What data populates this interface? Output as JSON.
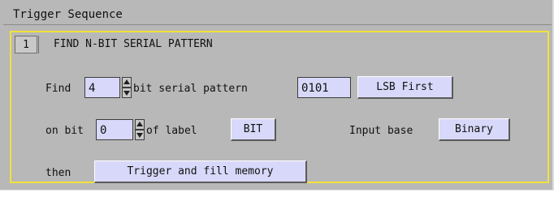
{
  "window": {
    "title": "Trigger Sequence"
  },
  "step": {
    "number": "1",
    "title": "FIND N-BIT SERIAL PATTERN"
  },
  "row1": {
    "find_label": "Find",
    "bit_count": "4",
    "after_label": "bit serial pattern",
    "pattern": "0101",
    "order_button": "LSB First"
  },
  "row2": {
    "on_bit_label": "on bit",
    "bit_value": "0",
    "of_label": "of label",
    "label_button": "BIT",
    "input_base_label": "Input base",
    "input_base_button": "Binary"
  },
  "row3": {
    "then_label": "then",
    "action_button": "Trigger and fill memory"
  },
  "colors": {
    "panel_border": "#f2e23a",
    "field_bg": "#d8d8fa",
    "window_bg": "#b8b8b8"
  }
}
